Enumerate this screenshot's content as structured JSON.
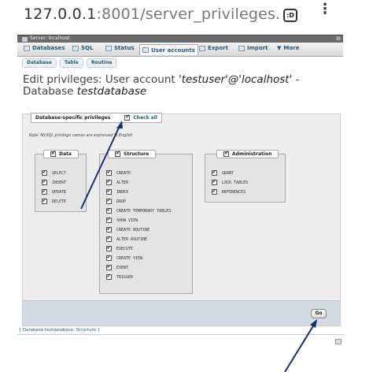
{
  "browser": {
    "url_host": "127.0.0.1",
    "url_rest": ":8001/server_privileges.",
    "tab_icon_label": ":D"
  },
  "server_bar": {
    "label": "Server: localhost"
  },
  "menu": {
    "items": [
      {
        "label": "Databases",
        "icon": "database-icon"
      },
      {
        "label": "SQL",
        "icon": "sql-icon"
      },
      {
        "label": "Status",
        "icon": "status-icon"
      },
      {
        "label": "User accounts",
        "icon": "users-icon"
      },
      {
        "label": "Export",
        "icon": "export-icon"
      },
      {
        "label": "Import",
        "icon": "import-icon"
      },
      {
        "label": "More",
        "icon": "chevron-down-icon"
      }
    ]
  },
  "subtabs": [
    "Database",
    "Table",
    "Routine"
  ],
  "title": {
    "prefix": "Edit privileges: User account ",
    "account": "'testuser'@'localhost'",
    "middle": " - Database ",
    "database": "testdatabase"
  },
  "panel": {
    "legend_label": "Database-specific privileges",
    "check_all_label": "Check all",
    "note": "Note: MySQL privilege names are expressed in English",
    "groups": [
      {
        "name": "Data",
        "items": [
          "SELECT",
          "INSERT",
          "UPDATE",
          "DELETE"
        ]
      },
      {
        "name": "Structure",
        "items": [
          "CREATE",
          "ALTER",
          "INDEX",
          "DROP",
          "CREATE TEMPORARY TABLES",
          "SHOW VIEW",
          "CREATE ROUTINE",
          "ALTER ROUTINE",
          "EXECUTE",
          "CREATE VIEW",
          "EVENT",
          "TRIGGER"
        ]
      },
      {
        "name": "Administration",
        "items": [
          "GRANT",
          "LOCK TABLES",
          "REFERENCES"
        ]
      }
    ],
    "go_label": "Go"
  },
  "breadcrumb_link": "[ Database testdatabase: Structure ]",
  "colors": {
    "link": "#235a81",
    "arrow": "#1a2f6b"
  }
}
